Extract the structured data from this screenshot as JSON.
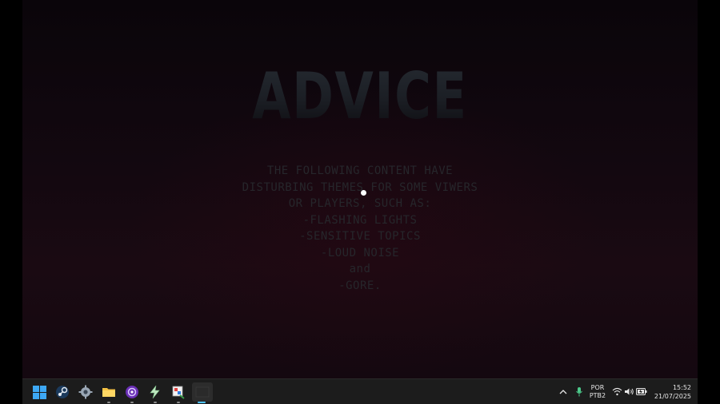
{
  "game": {
    "title": "ADVICE",
    "warning_lines": [
      "THE FOLLOWING CONTENT HAVE",
      "DISTURBING THEMES FOR SOME VIWERS",
      "OR PLAYERS, SUCH AS:",
      "-FLASHING LIGHTS",
      "-SENSITIVE TOPICS",
      "-LOUD NOISE",
      "and",
      "-GORE."
    ]
  },
  "taskbar": {
    "apps": [
      {
        "name": "start-button",
        "icon": "windows-logo-icon"
      },
      {
        "name": "steam",
        "icon": "steam-icon"
      },
      {
        "name": "settings",
        "icon": "gear-icon"
      },
      {
        "name": "file-explorer",
        "icon": "folder-icon"
      },
      {
        "name": "app-purple",
        "icon": "purple-orb-icon"
      },
      {
        "name": "app-lightning",
        "icon": "lightning-icon"
      },
      {
        "name": "app-paint",
        "icon": "paint-icon"
      },
      {
        "name": "active-app",
        "icon": "blank-window-icon"
      }
    ],
    "tray": {
      "language_top": "POR",
      "language_bottom": "PTB2",
      "time": "15:52",
      "date": "21/07/2025"
    }
  },
  "colors": {
    "taskbar_bg": "#1c1c1c",
    "accent": "#4cc2ff",
    "title_text": "#23272e",
    "warning_text": "#26262b"
  }
}
